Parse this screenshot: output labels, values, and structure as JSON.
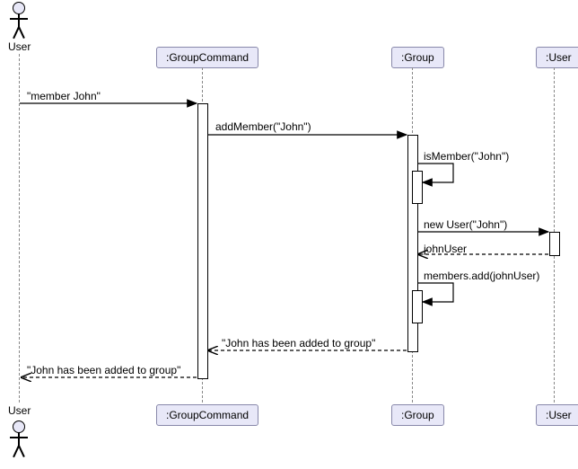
{
  "actors": {
    "user_top_label": "User",
    "user_bottom_label": "User"
  },
  "participants": {
    "group_command_top": ":GroupCommand",
    "group_command_bottom": ":GroupCommand",
    "group_top": ":Group",
    "group_bottom": ":Group",
    "user_class_top": ":User",
    "user_class_bottom": ":User"
  },
  "messages": {
    "m1": "\"member John\"",
    "m2": "addMember(\"John\")",
    "m3": "isMember(\"John\")",
    "m4": "new User(\"John\")",
    "m5": "johnUser",
    "m6": "members.add(johnUser)",
    "m7": "\"John has been added to group\"",
    "m8": "\"John has been added to group\""
  },
  "chart_data": {
    "type": "sequence-diagram",
    "participants": [
      {
        "id": "actor_user",
        "name": "User",
        "kind": "actor"
      },
      {
        "id": "group_command",
        "name": ":GroupCommand",
        "kind": "object"
      },
      {
        "id": "group",
        "name": ":Group",
        "kind": "object"
      },
      {
        "id": "user_class",
        "name": ":User",
        "kind": "object"
      }
    ],
    "messages": [
      {
        "from": "actor_user",
        "to": "group_command",
        "label": "\"member John\"",
        "style": "sync"
      },
      {
        "from": "group_command",
        "to": "group",
        "label": "addMember(\"John\")",
        "style": "sync"
      },
      {
        "from": "group",
        "to": "group",
        "label": "isMember(\"John\")",
        "style": "self"
      },
      {
        "from": "group",
        "to": "user_class",
        "label": "new User(\"John\")",
        "style": "sync"
      },
      {
        "from": "user_class",
        "to": "group",
        "label": "johnUser",
        "style": "return"
      },
      {
        "from": "group",
        "to": "group",
        "label": "members.add(johnUser)",
        "style": "self"
      },
      {
        "from": "group",
        "to": "group_command",
        "label": "\"John has been added to group\"",
        "style": "return"
      },
      {
        "from": "group_command",
        "to": "actor_user",
        "label": "\"John has been added to group\"",
        "style": "return"
      }
    ]
  }
}
